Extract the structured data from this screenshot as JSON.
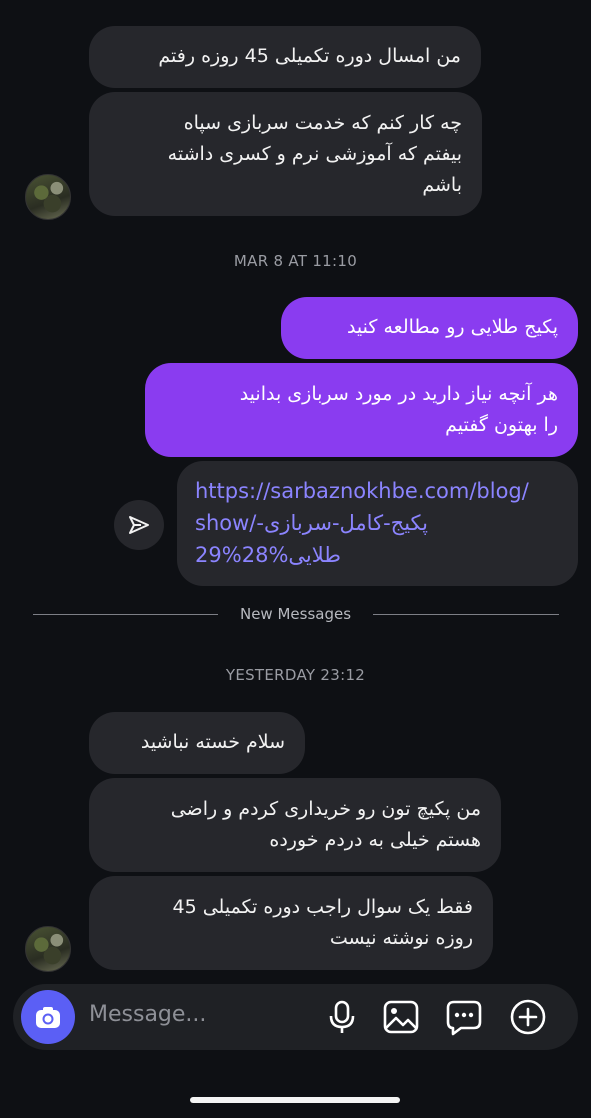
{
  "thread": {
    "msg1": "من امسال دوره تکمیلی 45 روزه رفتم",
    "msg2_lines": [
      "چه کار کنم که خدمت سربازی سپاه",
      "بیفتم که آموزشی نرم و کسری داشته",
      "باشم"
    ],
    "ts1": "MAR 8 AT 11:10",
    "out1": "پکیج طلایی رو مطالعه کنید",
    "out2_lines": [
      "هر آنچه نیاز دارید در مورد سربازی بدانید",
      "را بهتون گفتیم"
    ],
    "link_lines": [
      "https://sarbaznokhbe.com/blog/",
      "show/-پکیج-کامل-سربازی",
      "طلایی%28%29"
    ],
    "new_messages_label": "New Messages",
    "ts2": "YESTERDAY 23:12",
    "msg3": "سلام خسته نباشید",
    "msg4_lines": [
      "من پکیچ تون رو خریداری کردم و راضی",
      "هستم خیلی به دردم خورده"
    ],
    "msg5_lines": [
      "فقط یک سوال راجب دوره تکمیلی 45",
      "روزه نوشته نیست"
    ]
  },
  "composer": {
    "placeholder": "Message..."
  },
  "colors": {
    "outgoing": "#8a3cf0",
    "incoming": "#26272c",
    "link": "#8b84ff",
    "camera_button": "#5b5ff5",
    "background": "#0e1014"
  },
  "icons": [
    "camera-icon",
    "microphone-icon",
    "gallery-icon",
    "sticker-icon",
    "add-icon",
    "share-icon"
  ]
}
